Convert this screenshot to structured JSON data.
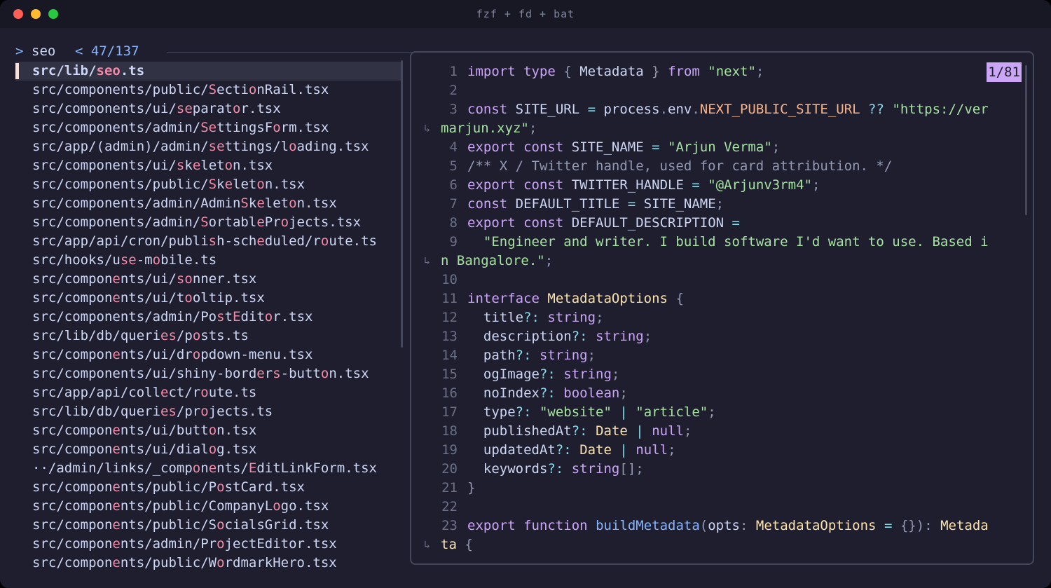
{
  "window": {
    "title": "fzf + fd + bat"
  },
  "prompt": {
    "caret": ">",
    "query": "seo",
    "counter": "< 47/137"
  },
  "results": [
    {
      "segs": [
        [
          "src/lib/",
          "n"
        ],
        [
          "seo",
          "m"
        ],
        [
          ".ts",
          "n"
        ]
      ],
      "selected": true
    },
    {
      "segs": [
        [
          "src/components/public/",
          "n"
        ],
        [
          "S",
          "m"
        ],
        [
          "ecti",
          "n"
        ],
        [
          "o",
          "m"
        ],
        [
          "nRail.tsx",
          "n"
        ]
      ]
    },
    {
      "segs": [
        [
          "src/components/ui/",
          "n"
        ],
        [
          "se",
          "m"
        ],
        [
          "parat",
          "n"
        ],
        [
          "o",
          "m"
        ],
        [
          "r.tsx",
          "n"
        ]
      ]
    },
    {
      "segs": [
        [
          "src/components/admin/",
          "n"
        ],
        [
          "Se",
          "m"
        ],
        [
          "ttingsF",
          "n"
        ],
        [
          "o",
          "m"
        ],
        [
          "rm.tsx",
          "n"
        ]
      ]
    },
    {
      "segs": [
        [
          "src/app/(admin)/admin/",
          "n"
        ],
        [
          "se",
          "m"
        ],
        [
          "ttings/l",
          "n"
        ],
        [
          "o",
          "m"
        ],
        [
          "ading.tsx",
          "n"
        ]
      ]
    },
    {
      "segs": [
        [
          "src/components/ui/",
          "n"
        ],
        [
          "s",
          "m"
        ],
        [
          "k",
          "n"
        ],
        [
          "e",
          "m"
        ],
        [
          "let",
          "n"
        ],
        [
          "o",
          "m"
        ],
        [
          "n.tsx",
          "n"
        ]
      ]
    },
    {
      "segs": [
        [
          "src/components/public/",
          "n"
        ],
        [
          "S",
          "m"
        ],
        [
          "k",
          "n"
        ],
        [
          "e",
          "m"
        ],
        [
          "let",
          "n"
        ],
        [
          "o",
          "m"
        ],
        [
          "n.tsx",
          "n"
        ]
      ]
    },
    {
      "segs": [
        [
          "src/components/admin/Admin",
          "n"
        ],
        [
          "S",
          "m"
        ],
        [
          "k",
          "n"
        ],
        [
          "e",
          "m"
        ],
        [
          "let",
          "n"
        ],
        [
          "o",
          "m"
        ],
        [
          "n.tsx",
          "n"
        ]
      ]
    },
    {
      "segs": [
        [
          "src/components/admin/",
          "n"
        ],
        [
          "S",
          "m"
        ],
        [
          "ortabl",
          "n"
        ],
        [
          "e",
          "m"
        ],
        [
          "Pr",
          "n"
        ],
        [
          "o",
          "m"
        ],
        [
          "jects.tsx",
          "n"
        ]
      ]
    },
    {
      "segs": [
        [
          "src/app/api/cron/publi",
          "n"
        ],
        [
          "s",
          "m"
        ],
        [
          "h-sch",
          "n"
        ],
        [
          "e",
          "m"
        ],
        [
          "duled/r",
          "n"
        ],
        [
          "o",
          "m"
        ],
        [
          "ute.ts",
          "n"
        ]
      ]
    },
    {
      "segs": [
        [
          "src/hooks/u",
          "n"
        ],
        [
          "se",
          "m"
        ],
        [
          "-m",
          "n"
        ],
        [
          "o",
          "m"
        ],
        [
          "bile.ts",
          "n"
        ]
      ]
    },
    {
      "segs": [
        [
          "src/compon",
          "n"
        ],
        [
          "e",
          "m"
        ],
        [
          "nts/ui/",
          "n"
        ],
        [
          "so",
          "m"
        ],
        [
          "nner.tsx",
          "n"
        ]
      ]
    },
    {
      "segs": [
        [
          "src/compon",
          "n"
        ],
        [
          "e",
          "m"
        ],
        [
          "nts/ui/t",
          "n"
        ],
        [
          "o",
          "m"
        ],
        [
          "oltip.tsx",
          "n"
        ]
      ]
    },
    {
      "segs": [
        [
          "src/components/admin/Po",
          "n"
        ],
        [
          "s",
          "m"
        ],
        [
          "t",
          "n"
        ],
        [
          "E",
          "m"
        ],
        [
          "dit",
          "n"
        ],
        [
          "o",
          "m"
        ],
        [
          "r.tsx",
          "n"
        ]
      ]
    },
    {
      "segs": [
        [
          "src/lib/db/queri",
          "n"
        ],
        [
          "es",
          "m"
        ],
        [
          "/p",
          "n"
        ],
        [
          "o",
          "m"
        ],
        [
          "sts.ts",
          "n"
        ]
      ]
    },
    {
      "segs": [
        [
          "src/compon",
          "n"
        ],
        [
          "e",
          "m"
        ],
        [
          "nts/ui/dr",
          "n"
        ],
        [
          "o",
          "m"
        ],
        [
          "pdown-menu.tsx",
          "n"
        ]
      ]
    },
    {
      "segs": [
        [
          "src/components/ui/shiny-bord",
          "n"
        ],
        [
          "e",
          "m"
        ],
        [
          "r",
          "n"
        ],
        [
          "s",
          "m"
        ],
        [
          "-butt",
          "n"
        ],
        [
          "o",
          "m"
        ],
        [
          "n.tsx",
          "n"
        ]
      ]
    },
    {
      "segs": [
        [
          "src/app/api/coll",
          "n"
        ],
        [
          "e",
          "m"
        ],
        [
          "ct/r",
          "n"
        ],
        [
          "o",
          "m"
        ],
        [
          "ute.ts",
          "n"
        ]
      ]
    },
    {
      "segs": [
        [
          "src/lib/db/queri",
          "n"
        ],
        [
          "es",
          "m"
        ],
        [
          "/pr",
          "n"
        ],
        [
          "o",
          "m"
        ],
        [
          "jects.ts",
          "n"
        ]
      ]
    },
    {
      "segs": [
        [
          "src/compon",
          "n"
        ],
        [
          "e",
          "m"
        ],
        [
          "nts/ui/butt",
          "n"
        ],
        [
          "o",
          "m"
        ],
        [
          "n.tsx",
          "n"
        ]
      ]
    },
    {
      "segs": [
        [
          "src/compon",
          "n"
        ],
        [
          "e",
          "m"
        ],
        [
          "nts/ui/dial",
          "n"
        ],
        [
          "o",
          "m"
        ],
        [
          "g.tsx",
          "n"
        ]
      ]
    },
    {
      "segs": [
        [
          "··/admin/links/_comp",
          "n"
        ],
        [
          "o",
          "m"
        ],
        [
          "n",
          "n"
        ],
        [
          "e",
          "m"
        ],
        [
          "nts/",
          "n"
        ],
        [
          "E",
          "m"
        ],
        [
          "ditLinkForm.tsx",
          "n"
        ]
      ]
    },
    {
      "segs": [
        [
          "src/compon",
          "n"
        ],
        [
          "e",
          "m"
        ],
        [
          "nts/public/P",
          "n"
        ],
        [
          "o",
          "m"
        ],
        [
          "stCard.tsx",
          "n"
        ]
      ]
    },
    {
      "segs": [
        [
          "src/compon",
          "n"
        ],
        [
          "e",
          "m"
        ],
        [
          "nts/public/CompanyL",
          "n"
        ],
        [
          "o",
          "m"
        ],
        [
          "go.tsx",
          "n"
        ]
      ]
    },
    {
      "segs": [
        [
          "src/compon",
          "n"
        ],
        [
          "e",
          "m"
        ],
        [
          "nts/public/S",
          "n"
        ],
        [
          "o",
          "m"
        ],
        [
          "cialsGrid.tsx",
          "n"
        ]
      ]
    },
    {
      "segs": [
        [
          "src/compon",
          "n"
        ],
        [
          "e",
          "m"
        ],
        [
          "nts/admin/Pr",
          "n"
        ],
        [
          "o",
          "m"
        ],
        [
          "jectEditor.tsx",
          "n"
        ]
      ]
    },
    {
      "segs": [
        [
          "src/compon",
          "n"
        ],
        [
          "e",
          "m"
        ],
        [
          "nts/public/W",
          "n"
        ],
        [
          "o",
          "m"
        ],
        [
          "rdmarkHero.tsx",
          "n"
        ]
      ]
    }
  ],
  "preview": {
    "position_badge": "1/81",
    "lines": [
      {
        "n": "1",
        "segs": [
          [
            "import",
            "k"
          ],
          [
            " ",
            ""
          ],
          [
            "type",
            "k"
          ],
          [
            " ",
            ""
          ],
          [
            "{",
            "pu"
          ],
          [
            " Metadata ",
            ""
          ],
          [
            "}",
            "pu"
          ],
          [
            " ",
            ""
          ],
          [
            "from",
            "k"
          ],
          [
            " ",
            ""
          ],
          [
            "\"next\"",
            "s"
          ],
          [
            ";",
            "pu"
          ]
        ]
      },
      {
        "n": "2",
        "segs": []
      },
      {
        "n": "3",
        "segs": [
          [
            "const",
            "k"
          ],
          [
            " SITE_URL ",
            ""
          ],
          [
            "=",
            "op"
          ],
          [
            " process",
            ""
          ],
          [
            ".",
            "pu"
          ],
          [
            "env",
            ""
          ],
          [
            ".",
            "pu"
          ],
          [
            "NEXT_PUBLIC_SITE_URL",
            "ev"
          ],
          [
            " ",
            ""
          ],
          [
            "??",
            "op"
          ],
          [
            " ",
            ""
          ],
          [
            "\"https://ver",
            "s"
          ]
        ]
      },
      {
        "n": "",
        "wrap": true,
        "segs": [
          [
            "marjun.xyz\"",
            "s"
          ],
          [
            ";",
            "pu"
          ]
        ]
      },
      {
        "n": "4",
        "segs": [
          [
            "export",
            "k"
          ],
          [
            " ",
            ""
          ],
          [
            "const",
            "k"
          ],
          [
            " SITE_NAME ",
            ""
          ],
          [
            "=",
            "op"
          ],
          [
            " ",
            ""
          ],
          [
            "\"Arjun Verma\"",
            "s"
          ],
          [
            ";",
            "pu"
          ]
        ]
      },
      {
        "n": "5",
        "segs": [
          [
            "/** X / Twitter handle, used for card attribution. */",
            "c"
          ]
        ]
      },
      {
        "n": "6",
        "segs": [
          [
            "export",
            "k"
          ],
          [
            " ",
            ""
          ],
          [
            "const",
            "k"
          ],
          [
            " TWITTER_HANDLE ",
            ""
          ],
          [
            "=",
            "op"
          ],
          [
            " ",
            ""
          ],
          [
            "\"@Arjunv3rm4\"",
            "s"
          ],
          [
            ";",
            "pu"
          ]
        ]
      },
      {
        "n": "7",
        "segs": [
          [
            "const",
            "k"
          ],
          [
            " DEFAULT_TITLE ",
            ""
          ],
          [
            "=",
            "op"
          ],
          [
            " SITE_NAME",
            ""
          ],
          [
            ";",
            "pu"
          ]
        ]
      },
      {
        "n": "8",
        "segs": [
          [
            "export",
            "k"
          ],
          [
            " ",
            ""
          ],
          [
            "const",
            "k"
          ],
          [
            " DEFAULT_DESCRIPTION ",
            ""
          ],
          [
            "=",
            "op"
          ]
        ]
      },
      {
        "n": "9",
        "segs": [
          [
            "  ",
            ""
          ],
          [
            "\"Engineer and writer. I build software I'd want to use. Based i",
            "s"
          ]
        ]
      },
      {
        "n": "",
        "wrap": true,
        "segs": [
          [
            "n Bangalore.\"",
            "s"
          ],
          [
            ";",
            "pu"
          ]
        ]
      },
      {
        "n": "10",
        "segs": []
      },
      {
        "n": "11",
        "segs": [
          [
            "interface",
            "k"
          ],
          [
            " ",
            ""
          ],
          [
            "MetadataOptions",
            "ty"
          ],
          [
            " ",
            ""
          ],
          [
            "{",
            "pu"
          ]
        ]
      },
      {
        "n": "12",
        "segs": [
          [
            "  title",
            ""
          ],
          [
            "?:",
            "op"
          ],
          [
            " ",
            ""
          ],
          [
            "string",
            "k"
          ],
          [
            ";",
            "pu"
          ]
        ]
      },
      {
        "n": "13",
        "segs": [
          [
            "  description",
            ""
          ],
          [
            "?:",
            "op"
          ],
          [
            " ",
            ""
          ],
          [
            "string",
            "k"
          ],
          [
            ";",
            "pu"
          ]
        ]
      },
      {
        "n": "14",
        "segs": [
          [
            "  path",
            ""
          ],
          [
            "?:",
            "op"
          ],
          [
            " ",
            ""
          ],
          [
            "string",
            "k"
          ],
          [
            ";",
            "pu"
          ]
        ]
      },
      {
        "n": "15",
        "segs": [
          [
            "  ogImage",
            ""
          ],
          [
            "?:",
            "op"
          ],
          [
            " ",
            ""
          ],
          [
            "string",
            "k"
          ],
          [
            ";",
            "pu"
          ]
        ]
      },
      {
        "n": "16",
        "segs": [
          [
            "  noIndex",
            ""
          ],
          [
            "?:",
            "op"
          ],
          [
            " ",
            ""
          ],
          [
            "boolean",
            "k"
          ],
          [
            ";",
            "pu"
          ]
        ]
      },
      {
        "n": "17",
        "segs": [
          [
            "  type",
            ""
          ],
          [
            "?:",
            "op"
          ],
          [
            " ",
            ""
          ],
          [
            "\"website\"",
            "s"
          ],
          [
            " ",
            ""
          ],
          [
            "|",
            "op"
          ],
          [
            " ",
            ""
          ],
          [
            "\"article\"",
            "s"
          ],
          [
            ";",
            "pu"
          ]
        ]
      },
      {
        "n": "18",
        "segs": [
          [
            "  publishedAt",
            ""
          ],
          [
            "?:",
            "op"
          ],
          [
            " ",
            ""
          ],
          [
            "Date",
            "ty"
          ],
          [
            " ",
            ""
          ],
          [
            "|",
            "op"
          ],
          [
            " ",
            ""
          ],
          [
            "null",
            "k"
          ],
          [
            ";",
            "pu"
          ]
        ]
      },
      {
        "n": "19",
        "segs": [
          [
            "  updatedAt",
            ""
          ],
          [
            "?:",
            "op"
          ],
          [
            " ",
            ""
          ],
          [
            "Date",
            "ty"
          ],
          [
            " ",
            ""
          ],
          [
            "|",
            "op"
          ],
          [
            " ",
            ""
          ],
          [
            "null",
            "k"
          ],
          [
            ";",
            "pu"
          ]
        ]
      },
      {
        "n": "20",
        "segs": [
          [
            "  keywords",
            ""
          ],
          [
            "?:",
            "op"
          ],
          [
            " ",
            ""
          ],
          [
            "string",
            "k"
          ],
          [
            "[]",
            "pu"
          ],
          [
            ";",
            "pu"
          ]
        ]
      },
      {
        "n": "21",
        "segs": [
          [
            "}",
            "pu"
          ]
        ]
      },
      {
        "n": "22",
        "segs": []
      },
      {
        "n": "23",
        "segs": [
          [
            "export",
            "k"
          ],
          [
            " ",
            ""
          ],
          [
            "function",
            "k"
          ],
          [
            " ",
            ""
          ],
          [
            "buildMetadata",
            "fn"
          ],
          [
            "(",
            "pu"
          ],
          [
            "opts",
            ""
          ],
          [
            ":",
            "pu"
          ],
          [
            " ",
            ""
          ],
          [
            "MetadataOptions",
            "ty"
          ],
          [
            " ",
            ""
          ],
          [
            "=",
            "op"
          ],
          [
            " ",
            ""
          ],
          [
            "{})",
            "pu"
          ],
          [
            ":",
            "pu"
          ],
          [
            " ",
            ""
          ],
          [
            "Metada",
            "ty"
          ]
        ]
      },
      {
        "n": "",
        "wrap": true,
        "segs": [
          [
            "ta",
            "ty"
          ],
          [
            " ",
            ""
          ],
          [
            "{",
            "pu"
          ]
        ]
      }
    ]
  }
}
